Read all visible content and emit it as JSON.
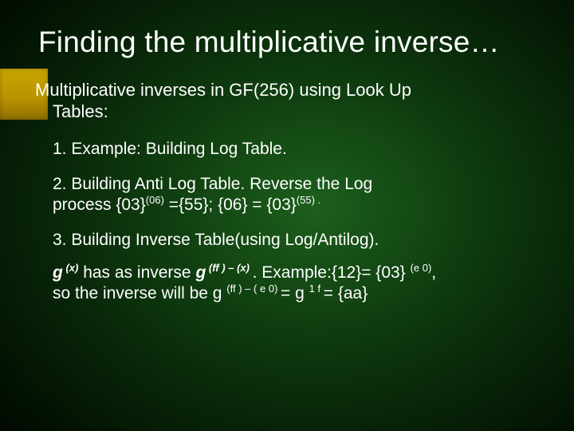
{
  "slide": {
    "title": "Finding the multiplicative inverse…",
    "intro_line1": "Multiplicative inverses in GF(256) using Look Up",
    "intro_line2": "Tables:",
    "item1": "1. Example:  Building Log Table.",
    "item2_a": "2. Building Anti Log Table. Reverse the Log",
    "item2_b": "process {03}",
    "item2_sup1": "(06)",
    "item2_c": " ={55}; {06} = {03}",
    "item2_sup2": "(55) .",
    "item3": "3. Building Inverse Table(using Log/Antilog).",
    "item4_g1": "g",
    "item4_sup1": " (x)",
    "item4_a": "  has as inverse ",
    "item4_g2": "g",
    "item4_sup2": " (ff ) – (x) ",
    "item4_b": ". Example:{12}= {03} ",
    "item4_sup3": "(e 0)",
    "item4_c": ",",
    "item4_d": "so the inverse will be g ",
    "item4_sup4": "(ff ) – ( e 0) ",
    "item4_e": " = g ",
    "item4_sup5": "1 f ",
    "item4_f": " = {aa}"
  }
}
